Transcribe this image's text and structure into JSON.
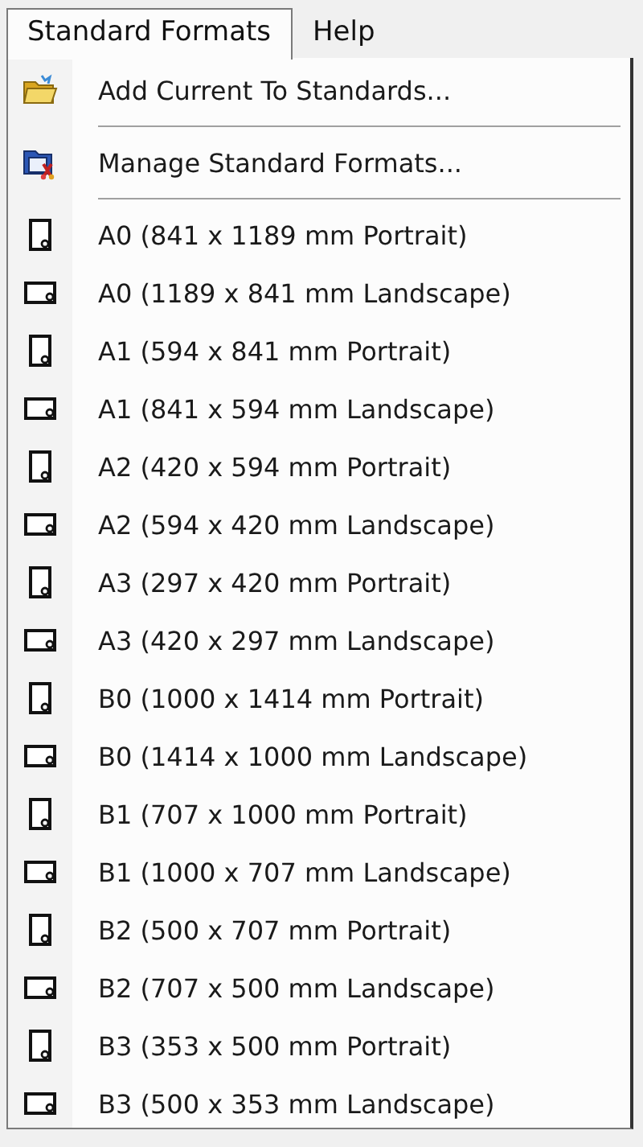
{
  "menubar": [
    {
      "label": "Standard Formats",
      "selected": true
    },
    {
      "label": "Help",
      "selected": false
    }
  ],
  "menu": {
    "items": [
      {
        "kind": "add",
        "label": "Add Current To Standards..."
      },
      {
        "kind": "separator"
      },
      {
        "kind": "manage",
        "label": "Manage Standard Formats..."
      },
      {
        "kind": "separator"
      },
      {
        "kind": "portrait",
        "label": "A0 (841 x 1189 mm Portrait)"
      },
      {
        "kind": "landscape",
        "label": "A0 (1189 x 841 mm Landscape)"
      },
      {
        "kind": "portrait",
        "label": "A1 (594 x 841 mm Portrait)"
      },
      {
        "kind": "landscape",
        "label": "A1 (841 x 594 mm Landscape)"
      },
      {
        "kind": "portrait",
        "label": "A2 (420 x 594 mm Portrait)"
      },
      {
        "kind": "landscape",
        "label": "A2 (594 x 420 mm Landscape)"
      },
      {
        "kind": "portrait",
        "label": "A3 (297 x 420 mm Portrait)"
      },
      {
        "kind": "landscape",
        "label": "A3 (420 x 297 mm Landscape)"
      },
      {
        "kind": "portrait",
        "label": "B0 (1000 x 1414 mm Portrait)"
      },
      {
        "kind": "landscape",
        "label": "B0 (1414 x 1000 mm Landscape)"
      },
      {
        "kind": "portrait",
        "label": "B1 (707 x 1000 mm Portrait)"
      },
      {
        "kind": "landscape",
        "label": "B1 (1000 x 707 mm Landscape)"
      },
      {
        "kind": "portrait",
        "label": "B2 (500 x 707 mm Portrait)"
      },
      {
        "kind": "landscape",
        "label": "B2 (707 x 500 mm Landscape)"
      },
      {
        "kind": "portrait",
        "label": "B3 (353 x 500 mm Portrait)"
      },
      {
        "kind": "landscape",
        "label": "B3 (500 x 353 mm Landscape)"
      }
    ]
  }
}
